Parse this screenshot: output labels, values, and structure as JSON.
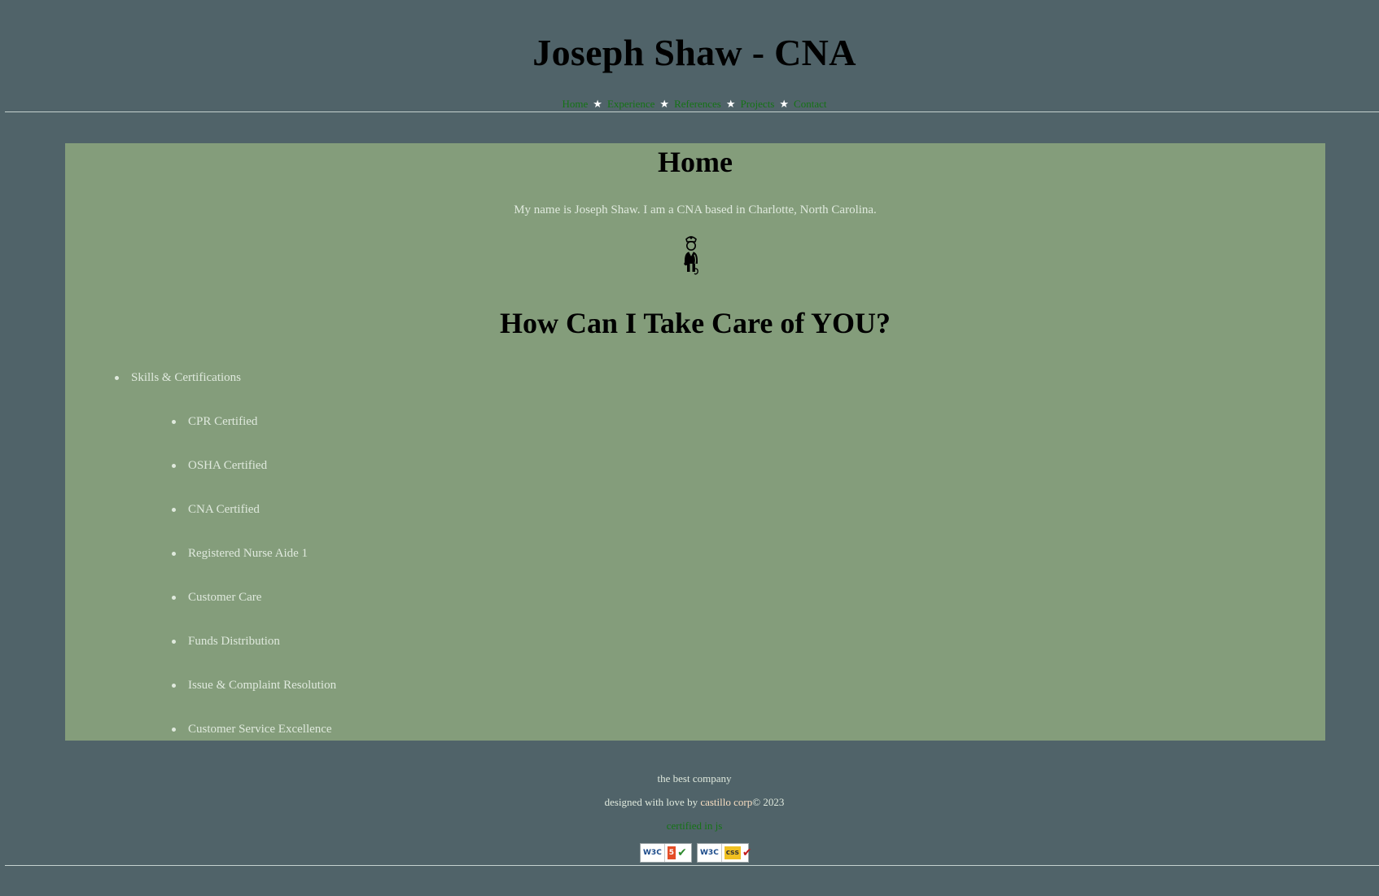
{
  "header": {
    "title": "Joseph Shaw - CNA",
    "nav": [
      {
        "label": "Home"
      },
      {
        "label": "Experience"
      },
      {
        "label": "References"
      },
      {
        "label": "Projects"
      },
      {
        "label": "Contact"
      }
    ],
    "separator": "★"
  },
  "main": {
    "heading": "Home",
    "intro": "My name is Joseph Shaw. I am a CNA based in Charlotte, North Carolina.",
    "image_icon": "nurse-icon",
    "subheading": "How Can I Take Care of YOU?",
    "skills": {
      "label": "Skills & Certifications",
      "items": [
        "CPR Certified",
        "OSHA Certified",
        "CNA Certified",
        "Registered Nurse Aide 1",
        "Customer Care",
        "Funds Distribution",
        "Issue & Complaint Resolution",
        "Customer Service Excellence"
      ]
    }
  },
  "footer": {
    "company": "the best company",
    "credit_prefix": "designed with love by ",
    "credit_brand": "castillo corp",
    "credit_suffix": "© 2023",
    "certified": "certified in js",
    "badges": {
      "html": {
        "org": "W3C",
        "kind": "HTML5"
      },
      "css": {
        "org": "W3C",
        "kind": "css"
      }
    }
  },
  "colors": {
    "page_bg": "#506369",
    "panel_bg": "#849d7b",
    "link": "#157315",
    "text_light": "#dfe9dd"
  }
}
